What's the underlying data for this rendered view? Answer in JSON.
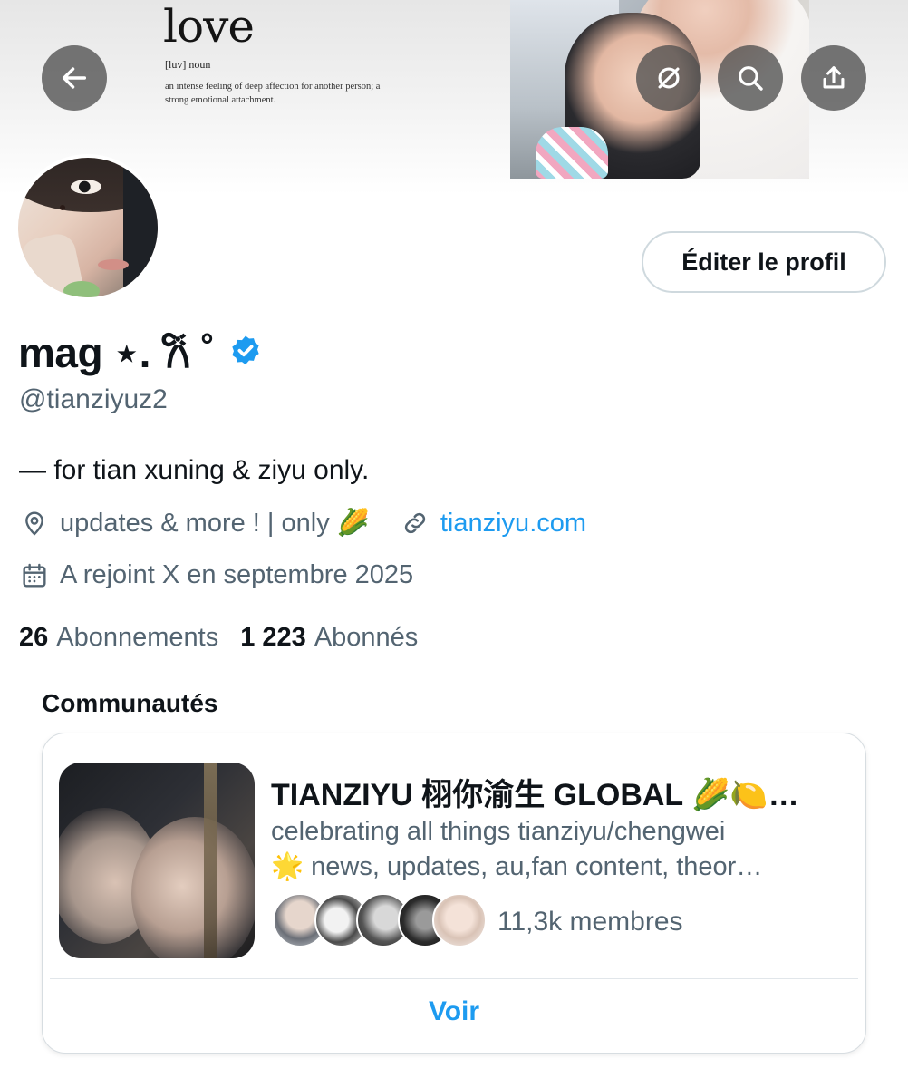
{
  "banner": {
    "dictionary_word": "love",
    "dictionary_pronunciation": "[luv] noun",
    "dictionary_definition": "an intense feeling of deep affection for another person; a strong emotional attachment."
  },
  "icons": {
    "back": "arrow-left-icon",
    "no_translate": "circle-slash-icon",
    "search": "search-icon",
    "share": "share-upload-icon",
    "verified": "verified-badge-icon",
    "location": "location-pin-icon",
    "link": "link-icon",
    "calendar": "calendar-icon"
  },
  "profile": {
    "display_name": "mag ⋆. 𐙚 ˚",
    "handle": "@tianziyuz2",
    "bio": "— for tian xuning & ziyu only.",
    "location": "updates & more ! | only 🌽",
    "website": "tianziyu.com",
    "joined": "A rejoint X en septembre 2025",
    "edit_button": "Éditer le profil"
  },
  "stats": {
    "following_count": "26",
    "following_label": "Abonnements",
    "followers_count": "1 223",
    "followers_label": "Abonnés"
  },
  "communities": {
    "section_title": "Communautés",
    "card": {
      "name": "TIANZIYU 栩你渝生 GLOBAL 🌽🍋…",
      "description_line1": "celebrating all things tianziyu/chengwei",
      "description_line2": "🌟 news, updates, au,fan content, theor…",
      "member_count": "11,3k membres",
      "action": "Voir"
    }
  },
  "colors": {
    "accent": "#1d9bf0",
    "text_primary": "#0f1419",
    "text_secondary": "#536471",
    "border": "#cfd9de"
  }
}
